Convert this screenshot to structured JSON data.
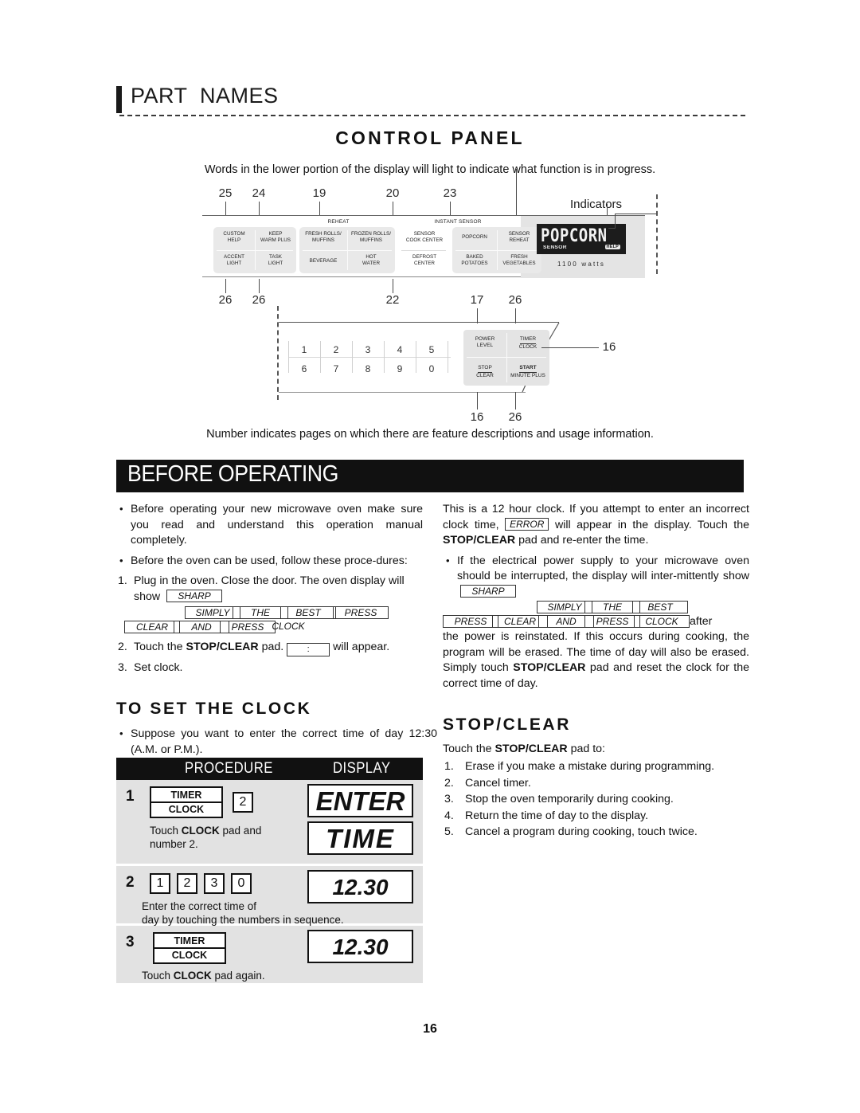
{
  "page": {
    "chapter_title": "PART  NAMES",
    "section_title": "CONTROL PANEL",
    "intro": "Words in the lower portion of the display will light to indicate what function is in progress.",
    "diagram_footer": "Number indicates pages on which there are feature descriptions and usage information.",
    "page_number": "16"
  },
  "diagram": {
    "indicators_label": "Indicators",
    "top_callouts": [
      "25",
      "24",
      "19",
      "20",
      "23"
    ],
    "mid_callouts": [
      "26",
      "26",
      "22",
      "17",
      "26"
    ],
    "bottom_callouts": [
      "16",
      "26"
    ],
    "right_callout": "16",
    "group_labels": {
      "reheat": "REHEAT",
      "instant_sensor": "INSTANT SENSOR"
    },
    "pads": {
      "custom_help": "CUSTOM\nHELP",
      "keep_warm_plus": "KEEP\nWARM PLUS",
      "accent_light": "ACCENT\nLIGHT",
      "task_light": "TASK\nLIGHT",
      "fresh_rolls_muffins": "FRESH ROLLS/\nMUFFINS",
      "frozen_rolls_muffins": "FROZEN ROLLS/\nMUFFINS",
      "beverage": "BEVERAGE",
      "hot_water": "HOT\nWATER",
      "sensor_cook_center": "SENSOR\nCOOK CENTER",
      "defrost_center": "DEFROST\nCENTER",
      "popcorn": "POPCORN",
      "sensor_reheat": "SENSOR\nREHEAT",
      "baked_potatoes": "BAKED\nPOTATOES",
      "fresh_vegetables": "FRESH\nVEGETABLES"
    },
    "display": {
      "main_text": "POPCORN",
      "sensor_indicator": "SENSOR",
      "help_indicator": "HELP",
      "wattage": "1100 watts"
    },
    "number_keys": [
      "1",
      "2",
      "3",
      "4",
      "5",
      "6",
      "7",
      "8",
      "9",
      "0"
    ],
    "function_pads": {
      "power_level": "POWER\nLEVEL",
      "timer_clock_top": "TIMER",
      "timer_clock_bot": "CLOCK",
      "stop_top": "STOP",
      "stop_bot": "CLEAR",
      "start_top": "START",
      "start_bot": "MINUTE PLUS"
    }
  },
  "before_operating": {
    "banner": "BEFORE OPERATING",
    "left": {
      "bullet1": "Before operating your new microwave oven make sure you read and understand this operation manual completely.",
      "bullet2": "Before the oven can be used, follow these proce-dures:",
      "item1_prefix": "1.",
      "item1_text": "Plug in the oven. Close the door. The oven display will show",
      "marquee1": [
        "SHARP",
        "SIMPLY",
        "THE",
        "BEST",
        "PRESS",
        "CLEAR",
        "AND",
        "PRESS",
        "CLOCK"
      ],
      "item2_prefix": "2.",
      "item2_pre": "Touch the",
      "item2_bold": "STOP/CLEAR",
      "item2_mid": "pad.",
      "item2_boxchar": ":",
      "item2_post": "will appear.",
      "item3_prefix": "3.",
      "item3_text": "Set clock."
    },
    "right": {
      "para1_a": "This is a 12 hour clock. If you attempt to enter an incorrect clock time,",
      "para1_errorbox": "ERROR",
      "para1_b": "will appear in the display. Touch the",
      "para1_bold": "STOP/CLEAR",
      "para1_c": "pad and re-enter the time.",
      "bullet_a": "If the electrical power supply to your microwave oven should be interrupted, the display will inter-mittently show",
      "marquee2": [
        "SHARP",
        "SIMPLY",
        "THE",
        "BEST",
        "PRESS",
        "CLEAR",
        "AND",
        "PRESS",
        "CLOCK"
      ],
      "after_word": "after",
      "bullet_b": "the power is reinstated. If this occurs during cooking, the program will be erased. The time of day will also be erased. Simply touch",
      "bullet_bold": "STOP/CLEAR",
      "bullet_c": "pad and reset the clock for the correct time of day."
    }
  },
  "to_set_clock": {
    "heading": "TO SET THE CLOCK",
    "bullet": "Suppose you want to enter the correct time of day 12:30 (A.M. or P.M.).",
    "table": {
      "col_procedure": "PROCEDURE",
      "col_display": "DISPLAY",
      "rows": [
        {
          "step": "1",
          "pad_top": "TIMER",
          "pad_bot": "CLOCK",
          "numkey": "2",
          "caption": "Touch CLOCK pad and number 2.",
          "caption_pre": "Touch ",
          "caption_bold": "CLOCK",
          "caption_post": " pad and number 2.",
          "display1": "ENTER",
          "display2": "TIME"
        },
        {
          "step": "2",
          "keys": [
            "1",
            "2",
            "3",
            "0"
          ],
          "caption": "Enter the correct time of day by touching the numbers in sequence.",
          "caption_line1": "Enter the correct time of",
          "caption_line2": "day by touching the numbers in sequence.",
          "display1": "12.30"
        },
        {
          "step": "3",
          "pad_top": "TIMER",
          "pad_bot": "CLOCK",
          "caption_pre": "Touch ",
          "caption_bold": "CLOCK",
          "caption_post": " pad again.",
          "display1": "12.30"
        }
      ]
    }
  },
  "stop_clear": {
    "heading": "STOP/CLEAR",
    "intro_pre": "Touch the ",
    "intro_bold": "STOP/CLEAR",
    "intro_post": " pad to:",
    "items": [
      "Erase if you make a mistake during programming.",
      "Cancel timer.",
      "Stop the oven temporarily during cooking.",
      "Return the time of day to the display.",
      "Cancel a program during cooking, touch twice."
    ],
    "numbers": [
      "1.",
      "2.",
      "3.",
      "4.",
      "5."
    ]
  },
  "colors": {
    "ink": "#111111",
    "panel_gray": "#e9e9e9",
    "table_gray": "#e2e2e2",
    "banner_black": "#111111"
  }
}
